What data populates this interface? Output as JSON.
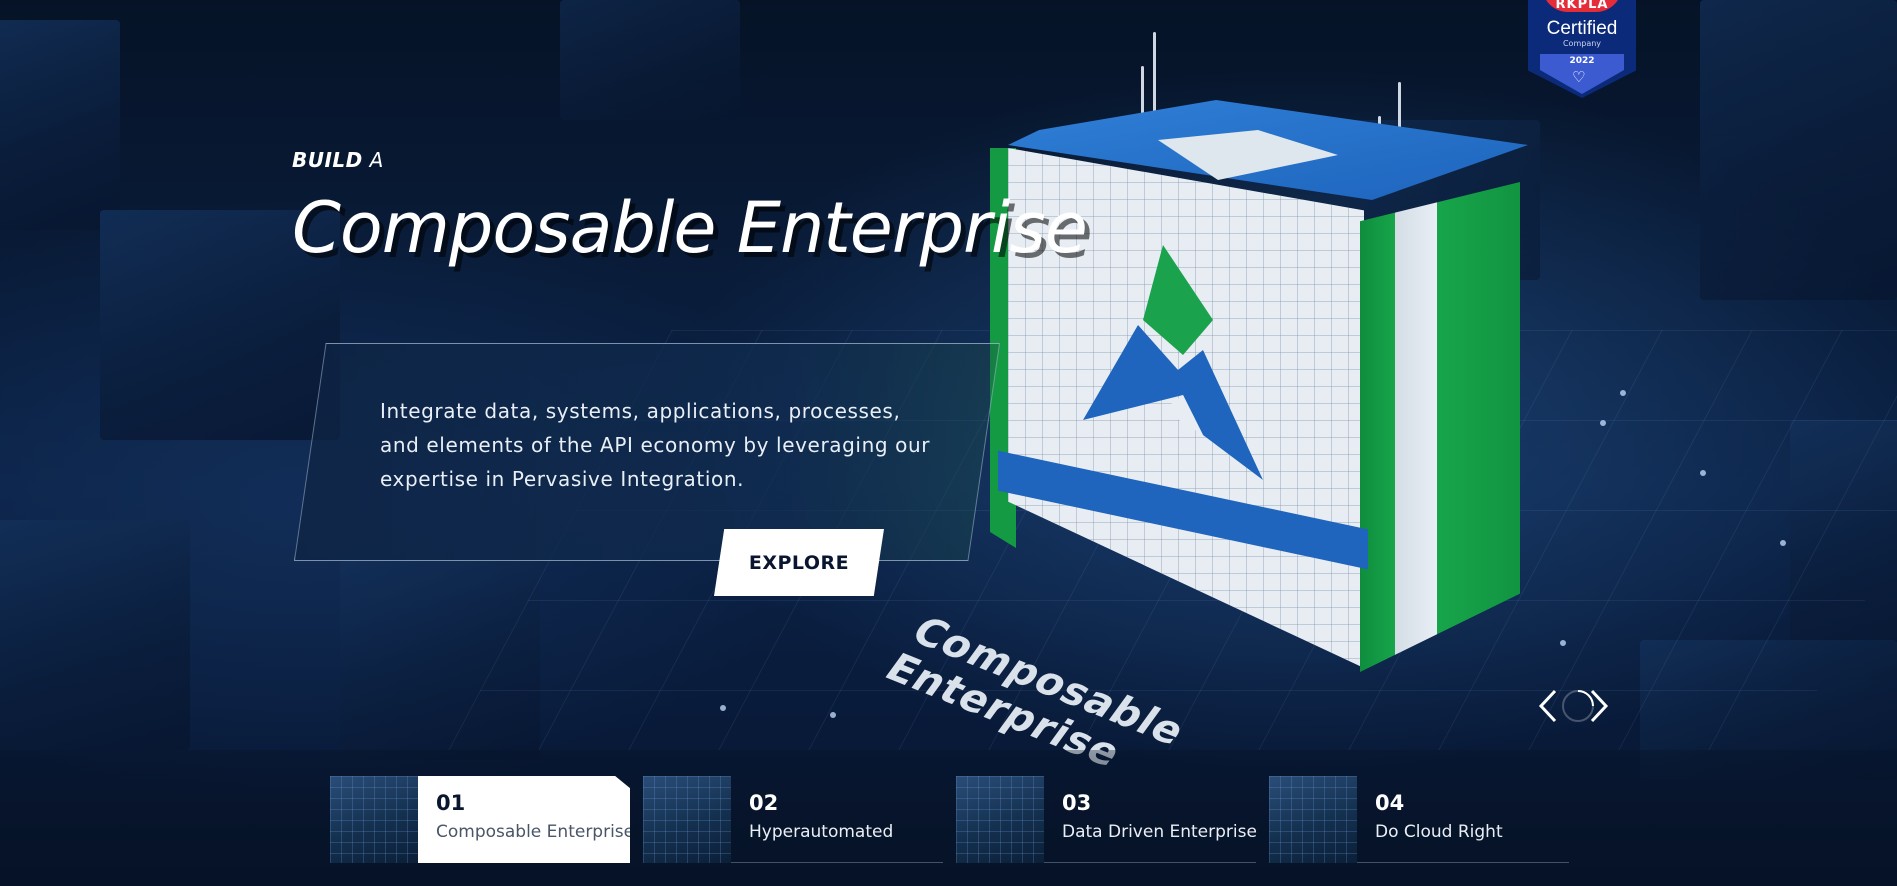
{
  "hero": {
    "eyebrow_bold": "BUILD",
    "eyebrow_light": "A",
    "title": "Composable Enterprise",
    "description": "Integrate data, systems, applications, processes, and elements of the API economy by leveraging our expertise in Pervasive Integration.",
    "cta_label": "EXPLORE",
    "floor_label_line1": "Composable",
    "floor_label_line2": "Enterprise"
  },
  "badge": {
    "top_text": "RKPLA",
    "certified": "Certified",
    "company": "Company",
    "year": "2022"
  },
  "slider": {
    "prev_icon": "chevron-left-icon",
    "next_icon": "chevron-right-icon"
  },
  "slides": [
    {
      "num": "01",
      "name": "Composable Enterprise",
      "active": true
    },
    {
      "num": "02",
      "name": "Hyperautomated",
      "active": false
    },
    {
      "num": "03",
      "name": "Data Driven Enterprise",
      "active": false
    },
    {
      "num": "04",
      "name": "Do Cloud Right",
      "active": false
    }
  ],
  "colors": {
    "background": "#0a1a33",
    "brand_blue": "#1f64bd",
    "brand_green": "#139a43",
    "badge_blue": "#0c2a7a",
    "badge_red": "#e52d3a"
  }
}
